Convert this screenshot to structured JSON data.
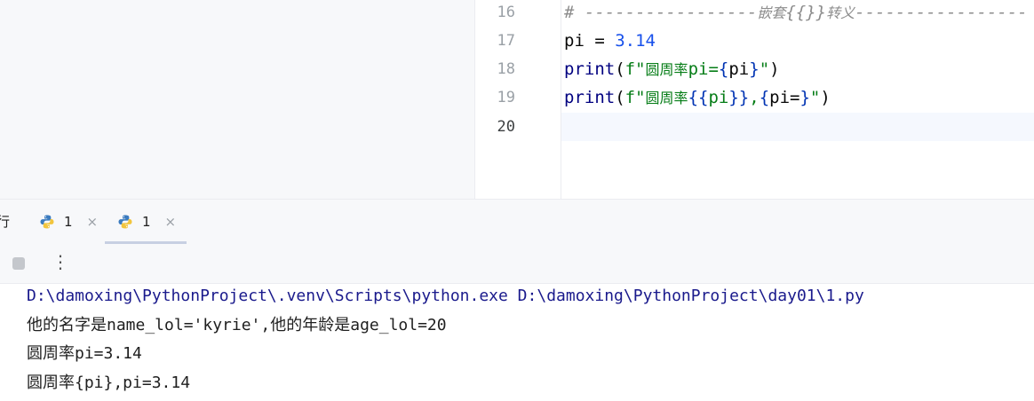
{
  "editor": {
    "lines": [
      {
        "no": "16",
        "parts": [
          {
            "cls": "cm",
            "text": "# -----------------"
          },
          {
            "cls": "cm cjk",
            "text": "嵌套"
          },
          {
            "cls": "cm",
            "text": "{{}}"
          },
          {
            "cls": "cm cjk",
            "text": "转义"
          },
          {
            "cls": "cm",
            "text": "-----------------"
          }
        ]
      },
      {
        "no": "17",
        "parts": [
          {
            "cls": "",
            "text": "pi = "
          },
          {
            "cls": "kw-num",
            "text": "3.14"
          }
        ]
      },
      {
        "no": "18",
        "parts": [
          {
            "cls": "fn",
            "text": "print"
          },
          {
            "cls": "",
            "text": "("
          },
          {
            "cls": "str",
            "text": "f\""
          },
          {
            "cls": "str cjk",
            "text": "圆周率"
          },
          {
            "cls": "str",
            "text": "pi="
          },
          {
            "cls": "brace",
            "text": "{"
          },
          {
            "cls": "",
            "text": "pi"
          },
          {
            "cls": "brace",
            "text": "}"
          },
          {
            "cls": "str",
            "text": "\""
          },
          {
            "cls": "",
            "text": ")"
          }
        ]
      },
      {
        "no": "19",
        "parts": [
          {
            "cls": "fn",
            "text": "print"
          },
          {
            "cls": "",
            "text": "("
          },
          {
            "cls": "str",
            "text": "f\""
          },
          {
            "cls": "str cjk",
            "text": "圆周率"
          },
          {
            "cls": "brace",
            "text": "{{"
          },
          {
            "cls": "str",
            "text": "pi"
          },
          {
            "cls": "brace",
            "text": "}}"
          },
          {
            "cls": "str",
            "text": ","
          },
          {
            "cls": "brace",
            "text": "{"
          },
          {
            "cls": "",
            "text": "pi="
          },
          {
            "cls": "brace",
            "text": "}"
          },
          {
            "cls": "str",
            "text": "\""
          },
          {
            "cls": "",
            "text": ")"
          }
        ]
      },
      {
        "no": "20",
        "parts": []
      }
    ]
  },
  "tool_window": {
    "title_cut": "行",
    "tabs": [
      {
        "label": "1",
        "close": "×"
      },
      {
        "label": "1",
        "close": "×"
      }
    ],
    "more_label": "⋮"
  },
  "console": {
    "command": "D:\\damoxing\\PythonProject\\.venv\\Scripts\\python.exe D:\\damoxing\\PythonProject\\day01\\1.py",
    "output": [
      "他的名字是name_lol='kyrie',他的年龄是age_lol=20",
      "圆周率pi=3.14",
      "圆周率{pi},pi=3.14"
    ]
  },
  "colors": {
    "comment": "#8c8c8c",
    "number": "#1750eb",
    "function": "#000080",
    "string": "#067d17",
    "brace": "#0033b3"
  }
}
